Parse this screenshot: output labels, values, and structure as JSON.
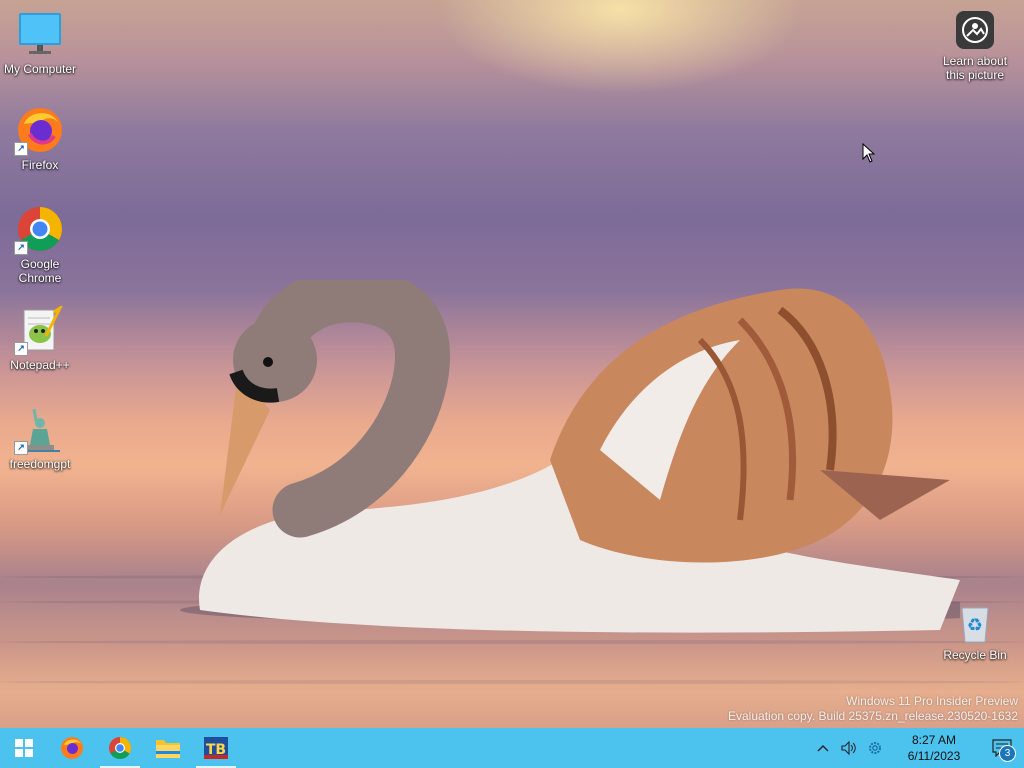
{
  "desktop": {
    "icons": [
      {
        "label": "My Computer",
        "icon": "monitor-icon"
      },
      {
        "label": "Firefox",
        "icon": "firefox-icon"
      },
      {
        "label": "Google Chrome",
        "icon": "chrome-icon"
      },
      {
        "label": "Notepad++",
        "icon": "notepadpp-icon"
      },
      {
        "label": "freedomgpt",
        "icon": "statue-of-liberty-icon"
      }
    ],
    "learn_about_picture": {
      "line1": "Learn about",
      "line2": "this picture",
      "icon": "camera-icon"
    },
    "recycle_bin": {
      "label": "Recycle Bin",
      "icon": "recycle-bin-icon"
    },
    "watermark": {
      "line1": "Windows 11 Pro Insider Preview",
      "line2": "Evaluation copy. Build 25375.zn_release.230520-1632"
    }
  },
  "taskbar": {
    "apps": [
      {
        "name": "Start",
        "icon": "windows-start-icon"
      },
      {
        "name": "Firefox",
        "icon": "firefox-icon"
      },
      {
        "name": "Google Chrome",
        "icon": "chrome-icon"
      },
      {
        "name": "File Explorer",
        "icon": "folder-icon"
      },
      {
        "name": "TB app",
        "icon": "tb-app-icon"
      }
    ],
    "tray": {
      "time": "8:27 AM",
      "date": "6/11/2023",
      "notification_count": "3"
    }
  },
  "colors": {
    "taskbar": "#4cc3ef",
    "accent": "#1b75bc"
  }
}
